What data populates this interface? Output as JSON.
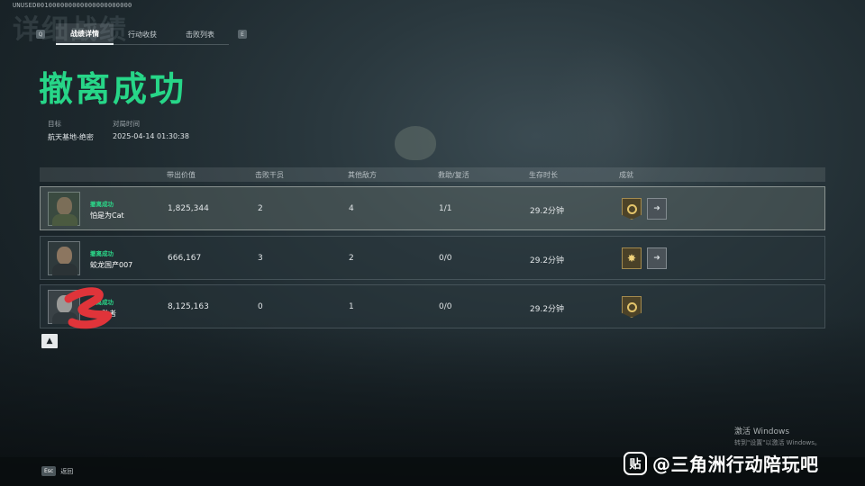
{
  "build_id": "UNUSED001000000000000000000000",
  "ghost_title": "详细战绩",
  "tabs": {
    "left_key": "Q",
    "right_key": "E",
    "items": [
      {
        "label": "战绩详情",
        "active": true
      },
      {
        "label": "行动收获",
        "active": false
      },
      {
        "label": "击败列表",
        "active": false
      }
    ]
  },
  "title": "撤离成功",
  "meta": {
    "target_label": "目标",
    "target_value": "航天基地-绝密",
    "time_label": "对局时间",
    "time_value": "2025-04-14 01:30:38"
  },
  "columns": {
    "value": "带出价值",
    "kills": "击败干员",
    "other": "其他敌方",
    "rescue": "救助/复活",
    "survival": "生存时长",
    "achievements": "成就"
  },
  "rows": [
    {
      "status": "撤离成功",
      "name": "怕是为Cat",
      "value": "1,825,344",
      "kills": "2",
      "other": "4",
      "rescue": "1/1",
      "survival": "29.2分钟",
      "badges": [
        "gold-medal",
        "gray-medal"
      ]
    },
    {
      "status": "撤离成功",
      "name": "蛟龙国产007",
      "value": "666,167",
      "kills": "3",
      "other": "2",
      "rescue": "0/0",
      "survival": "29.2分钟",
      "badges": [
        "star-medal",
        "gray-medal"
      ]
    },
    {
      "status": "撤离成功",
      "name": "敢者",
      "value": "8,125,163",
      "kills": "0",
      "other": "1",
      "rescue": "0/0",
      "survival": "29.2分钟",
      "badges": [
        "gold-medal"
      ]
    }
  ],
  "watermark": {
    "line1": "激活 Windows",
    "line2": "转到\"设置\"以激活 Windows。"
  },
  "footer": {
    "esc_key": "Esc",
    "esc_label": "返回"
  },
  "tieba": {
    "logo": "贴",
    "text": "@三角洲行动陪玩吧"
  },
  "colors": {
    "accent_green": "#27d688",
    "gold": "#e3c46a"
  }
}
